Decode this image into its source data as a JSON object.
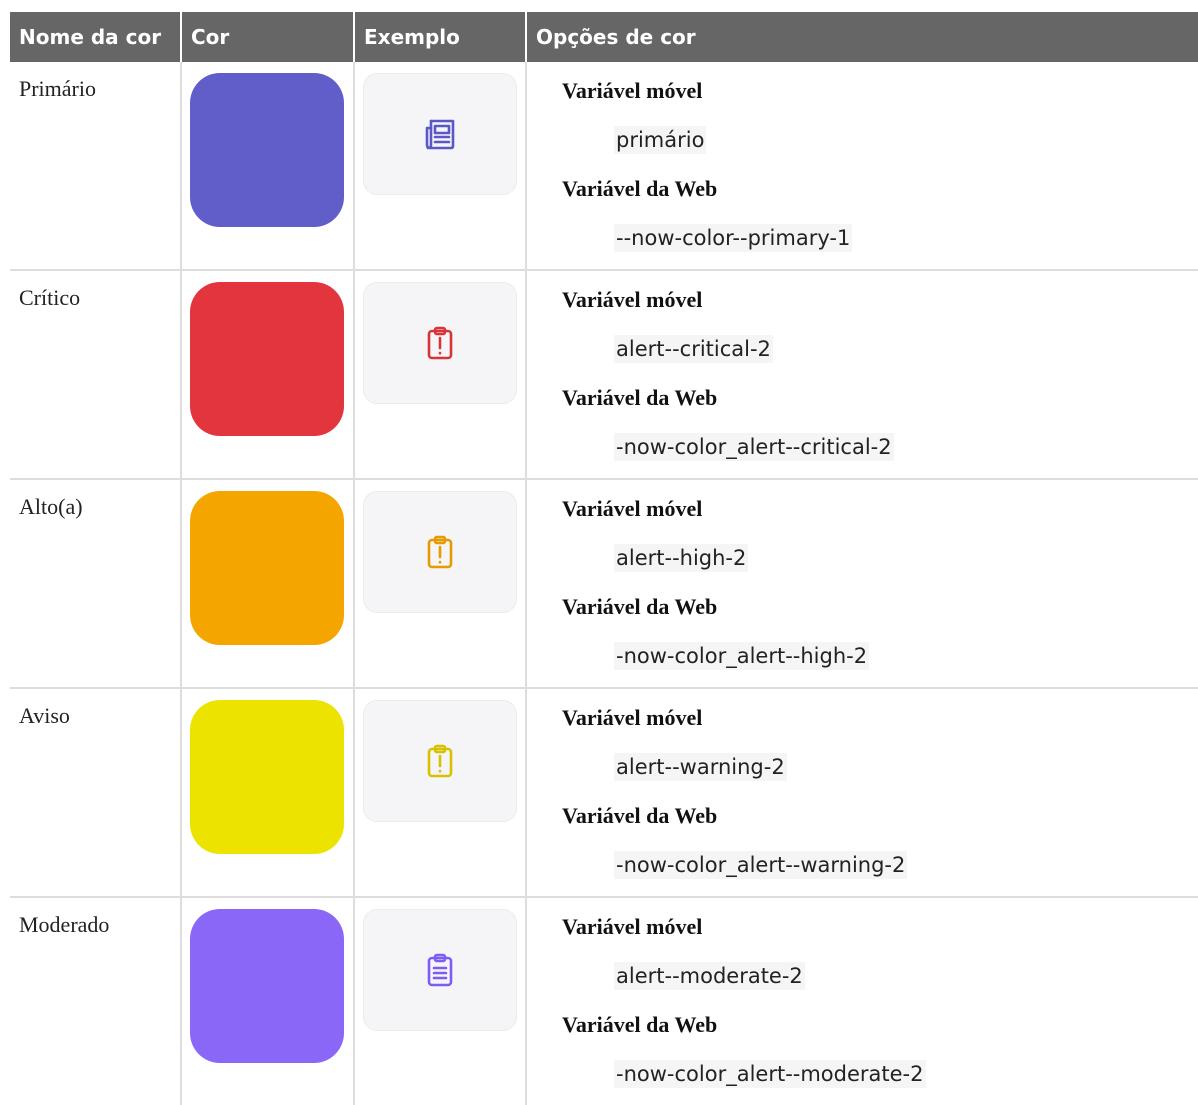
{
  "headers": [
    "Nome da cor",
    "Cor",
    "Exemplo",
    "Opções de cor"
  ],
  "rows": [
    {
      "name": "Primário",
      "color": "#615ec9",
      "icon": "newspaper-icon",
      "icon_color": "#5b57c7",
      "mobile_label": "Variável móvel",
      "mobile_value": "primário",
      "web_label": "Variável da Web",
      "web_value": "--now-color--primary-1"
    },
    {
      "name": "Crítico",
      "color": "#e3353e",
      "icon": "clipboard-alert-icon",
      "icon_color": "#d5343a",
      "mobile_label": "Variável móvel",
      "mobile_value": "alert--critical-2",
      "web_label": "Variável da Web",
      "web_value": "-now-color_alert--critical-2"
    },
    {
      "name": "Alto(a)",
      "color": "#f5a500",
      "icon": "clipboard-alert-icon",
      "icon_color": "#e69a00",
      "mobile_label": "Variável móvel",
      "mobile_value": "alert--high-2",
      "web_label": "Variável da Web",
      "web_value": "-now-color_alert--high-2"
    },
    {
      "name": "Aviso",
      "color": "#ece400",
      "icon": "clipboard-alert-icon",
      "icon_color": "#d8c200",
      "mobile_label": "Variável móvel",
      "mobile_value": "alert--warning-2",
      "web_label": "Variável da Web",
      "web_value": "-now-color_alert--warning-2"
    },
    {
      "name": "Moderado",
      "color": "#8b67f8",
      "icon": "clipboard-list-icon",
      "icon_color": "#7e5cf2",
      "mobile_label": "Variável móvel",
      "mobile_value": "alert--moderate-2",
      "web_label": "Variável da Web",
      "web_value": "-now-color_alert--moderate-2"
    }
  ]
}
